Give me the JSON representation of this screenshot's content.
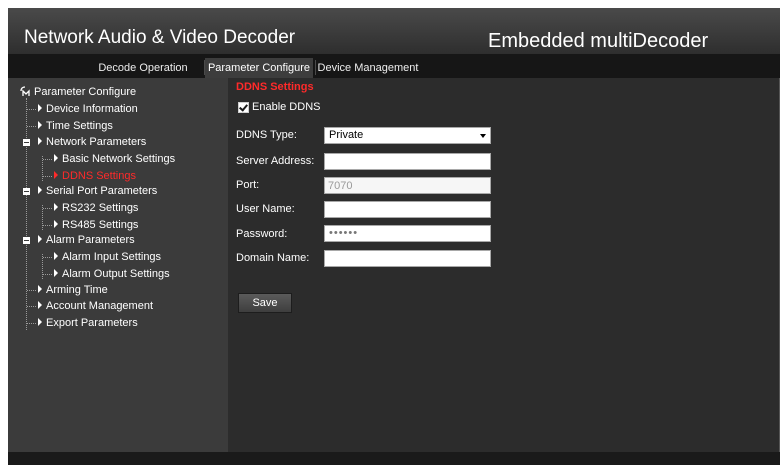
{
  "header": {
    "app_title": "Network Audio & Video Decoder",
    "product_title": "Embedded multiDecoder"
  },
  "tabs": [
    {
      "label": "Decode Operation",
      "active": false
    },
    {
      "label": "Parameter Configure",
      "active": true
    },
    {
      "label": "Device Management",
      "active": false
    }
  ],
  "tree": {
    "root": "Parameter Configure",
    "items": [
      {
        "label": "Device Information"
      },
      {
        "label": "Time Settings"
      },
      {
        "label": "Network Parameters",
        "expanded": true
      },
      {
        "label": "Basic Network Settings"
      },
      {
        "label": "DDNS Settings",
        "selected": true
      },
      {
        "label": "Serial Port Parameters",
        "expanded": true
      },
      {
        "label": "RS232 Settings"
      },
      {
        "label": "RS485 Settings"
      },
      {
        "label": "Alarm Parameters",
        "expanded": true
      },
      {
        "label": "Alarm Input Settings"
      },
      {
        "label": "Alarm Output Settings"
      },
      {
        "label": "Arming Time"
      },
      {
        "label": "Account Management"
      },
      {
        "label": "Export Parameters"
      }
    ]
  },
  "ddns": {
    "section_title": "DDNS Settings",
    "enable_label": "Enable DDNS",
    "enable_checked": true,
    "type_label": "DDNS Type:",
    "type_value": "Private",
    "server_label": "Server Address:",
    "server_value": "",
    "port_label": "Port:",
    "port_value": "7070",
    "user_label": "User Name:",
    "user_value": "",
    "password_label": "Password:",
    "password_value": "••••••",
    "domain_label": "Domain Name:",
    "domain_value": "",
    "save_label": "Save"
  },
  "colors": {
    "background": "#3b3b3b",
    "content_panel": "#2c2c2c",
    "tab_bar": "#161616",
    "selected_text": "#ff2a2a"
  }
}
